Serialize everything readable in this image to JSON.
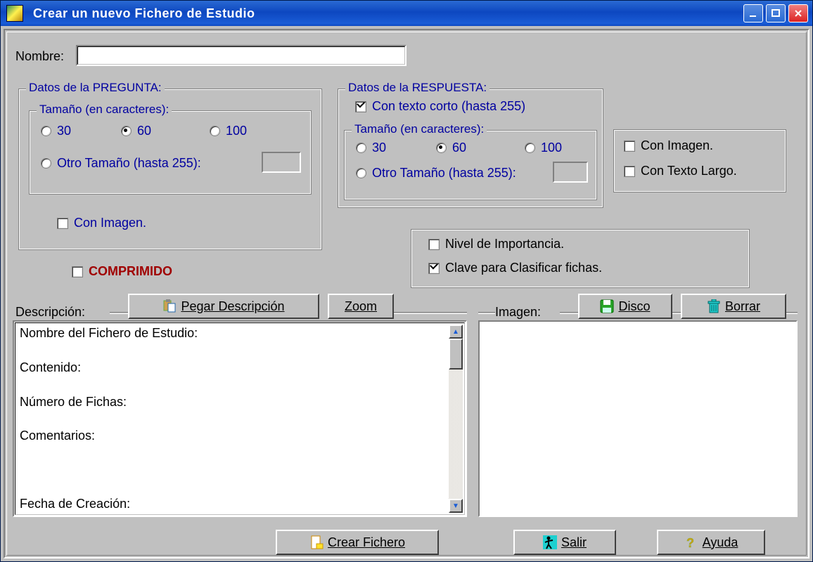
{
  "window": {
    "title": "Crear un nuevo Fichero de Estudio"
  },
  "name_field": {
    "label": "Nombre:",
    "value": ""
  },
  "pregunta_group": {
    "legend": "Datos de la PREGUNTA:",
    "size_legend": "Tamaño (en caracteres):",
    "opt_30": "30",
    "opt_60": "60",
    "opt_100": "100",
    "opt_other": "Otro Tamaño (hasta 255):",
    "other_value": "",
    "con_imagen": "Con Imagen."
  },
  "respuesta_group": {
    "legend": "Datos de la RESPUESTA:",
    "texto_corto": "Con texto corto (hasta 255)",
    "size_legend": "Tamaño (en caracteres):",
    "opt_30": "30",
    "opt_60": "60",
    "opt_100": "100",
    "opt_other": "Otro Tamaño (hasta 255):",
    "other_value": ""
  },
  "respuesta_extra": {
    "con_imagen": "Con Imagen.",
    "con_texto_largo": "Con Texto Largo."
  },
  "comprimido_label": "COMPRIMIDO",
  "classify_group": {
    "nivel": "Nivel de Importancia.",
    "clave": "Clave para Clasificar fichas."
  },
  "description_section": {
    "label": "Descripción:",
    "btn_pegar": "Pegar Descripción",
    "btn_zoom": "Zoom",
    "lines": {
      "l0": "Nombre del Fichero de Estudio:",
      "l1": "Contenido:",
      "l2": "Número de Fichas:",
      "l3": "Comentarios:",
      "l4": "Fecha de Creación:"
    }
  },
  "imagen_section": {
    "label": "Imagen:",
    "btn_disco": "Disco",
    "btn_borrar": "Borrar"
  },
  "bottom_buttons": {
    "crear": "Crear Fichero",
    "salir": "Salir",
    "ayuda": "Ayuda"
  }
}
